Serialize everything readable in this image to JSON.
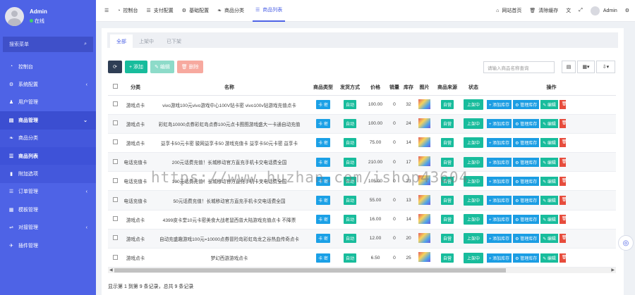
{
  "sidebar": {
    "user_name": "Admin",
    "user_status": "在线",
    "search_label": "搜索菜单",
    "items": [
      {
        "icon": "speedometer-icon",
        "glyph": "◔",
        "label": "控制台"
      },
      {
        "icon": "gear-icon",
        "glyph": "⚙",
        "label": "系统配置",
        "chevron": "‹"
      },
      {
        "icon": "user-icon",
        "glyph": "♟",
        "label": "用户管理"
      },
      {
        "icon": "cart-icon",
        "glyph": "▤",
        "label": "商品管理",
        "chevron": "⌄"
      },
      {
        "icon": "leaf-icon",
        "glyph": "❧",
        "label": "商品分类"
      },
      {
        "icon": "list-icon",
        "glyph": "☰",
        "label": "商品列表"
      },
      {
        "icon": "bookmark-icon",
        "glyph": "▮",
        "label": "附加选项"
      },
      {
        "icon": "order-list-icon",
        "glyph": "☰",
        "label": "订单管理",
        "chevron": "‹"
      },
      {
        "icon": "template-icon",
        "glyph": "▦",
        "label": "模板管理"
      },
      {
        "icon": "sliders-icon",
        "glyph": "⇌",
        "label": "对接管理",
        "chevron": "‹"
      },
      {
        "icon": "rocket-icon",
        "glyph": "✈",
        "label": "插件管理"
      }
    ]
  },
  "topbar": {
    "menu_glyph": "☰",
    "nav": [
      {
        "icon": "speedometer-icon",
        "glyph": "◔",
        "label": "控制台"
      },
      {
        "icon": "list-icon",
        "glyph": "☰",
        "label": "支付配置"
      },
      {
        "icon": "gear-icon",
        "glyph": "⚙",
        "label": "基础配置"
      },
      {
        "icon": "leaf-icon",
        "glyph": "❧",
        "label": "商品分类"
      },
      {
        "icon": "list-icon",
        "glyph": "☰",
        "label": "商品列表"
      }
    ],
    "right": {
      "home_label": "网站首页",
      "clear_cache_label": "清除缓存",
      "user_name": "Admin"
    }
  },
  "tabs": [
    "全部",
    "上架中",
    "已下架"
  ],
  "toolbar": {
    "refresh_glyph": "⟳",
    "add_label": "+ 添加",
    "edit_label": "✎ 编辑",
    "delete_label": "🗑 删除",
    "search_placeholder": "请输入商品名称查询"
  },
  "table": {
    "headers": [
      "分类",
      "名称",
      "商品类型",
      "发货方式",
      "价格",
      "销量",
      "库存",
      "图片",
      "商品来源",
      "状态",
      "操作"
    ],
    "rows": [
      {
        "category": "游戏点卡",
        "name": "vivo游戏100元vivo游戏中心100V钻卡密 vivo100v钻游戏充值点卡",
        "type": "卡 密",
        "delivery": "自动",
        "price": "100.00",
        "sales": "0",
        "stock": "32",
        "source": "自营",
        "status": "上架中"
      },
      {
        "category": "游戏点卡",
        "name": "彩虹岛10000点券彩虹岛点券100元点卡图图游戏盛大一卡通自动充值",
        "type": "卡 密",
        "delivery": "自动",
        "price": "100.00",
        "sales": "0",
        "stock": "24",
        "source": "自营",
        "status": "上架中"
      },
      {
        "category": "游戏点卡",
        "name": "益享卡50元卡密 骏网益享卡50 游戏充值卡 益享卡50元卡密 益享卡",
        "type": "卡 密",
        "delivery": "自动",
        "price": "75.00",
        "sales": "0",
        "stock": "14",
        "source": "自营",
        "status": "上架中"
      },
      {
        "category": "电话充值卡",
        "name": "200元话费充值！长城移动官方直充手机卡交电话费全国",
        "type": "卡 密",
        "delivery": "自动",
        "price": "210.00",
        "sales": "0",
        "stock": "17",
        "source": "自营",
        "status": "上架中"
      },
      {
        "category": "电话充值卡",
        "name": "100元话费充值！长城移动官方直充手机卡交电话费全国",
        "type": "卡 密",
        "delivery": "自动",
        "price": "105.00",
        "sales": "0",
        "stock": "23",
        "source": "自营",
        "status": "上架中"
      },
      {
        "category": "电话充值卡",
        "name": "50元话费充值！长城移动官方直充手机卡交电话费全国",
        "type": "卡 密",
        "delivery": "自动",
        "price": "55.00",
        "sales": "0",
        "stock": "13",
        "source": "自营",
        "status": "上架中"
      },
      {
        "category": "游戏点卡",
        "name": "4399皮卡堂10元卡密美食大战老鼠西普大陆游戏充值点卡 不降票",
        "type": "卡 密",
        "delivery": "自动",
        "price": "16.00",
        "sales": "0",
        "stock": "14",
        "source": "自营",
        "status": "上架中"
      },
      {
        "category": "游戏点卡",
        "name": "自动充盛趣游戏100元=10000点券冒险岛彩虹岛龙之谷热血传奇点卡",
        "type": "卡 密",
        "delivery": "自动",
        "price": "12.00",
        "sales": "0",
        "stock": "20",
        "source": "自营",
        "status": "上架中"
      },
      {
        "category": "游戏点卡",
        "name": "梦幻西游游戏点卡",
        "type": "卡 密",
        "delivery": "自动",
        "price": "6.50",
        "sales": "0",
        "stock": "25",
        "source": "自营",
        "status": "上架中"
      }
    ],
    "actions": {
      "add_stock": "+ 添加库存",
      "manage_stock": "⚙ 管理库存",
      "edit": "✎ 编辑"
    }
  },
  "footer_text": "显示第 1 到第 9 条记录，总共 9 条记录",
  "watermark": "https://www.huzhan.com/ishop43604"
}
